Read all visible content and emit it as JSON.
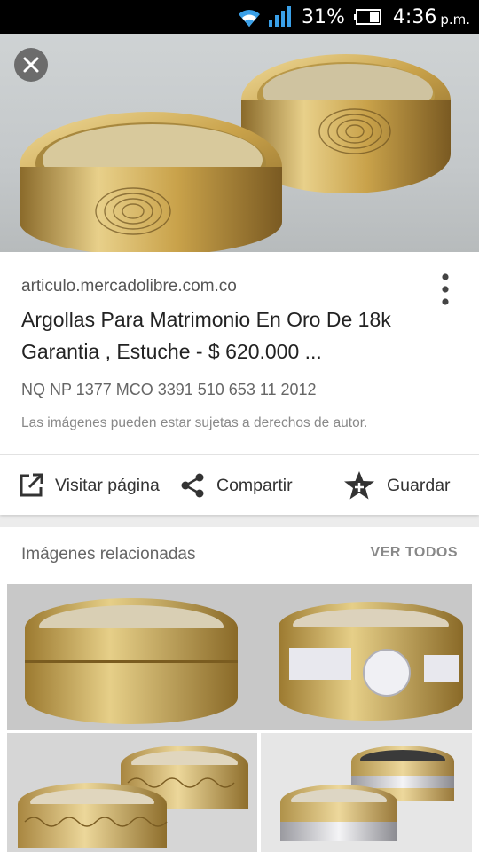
{
  "status_bar": {
    "battery_percent": "31%",
    "time": "4:36",
    "ampm": "p.m."
  },
  "hero": {
    "image_icon": "wedding-rings-photo",
    "close_icon": "close-icon"
  },
  "result": {
    "domain": "articulo.mercadolibre.com.co",
    "title": "Argollas Para Matrimonio En Oro De 18k Garantia , Estuche - $ 620.000 ...",
    "sku": "NQ NP 1377 MCO 3391 510 653 11 2012",
    "copyright": "Las imágenes pueden estar sujetas a derechos de autor."
  },
  "actions": {
    "visit_label": "Visitar página",
    "share_label": "Compartir",
    "save_label": "Guardar"
  },
  "related": {
    "title": "Imágenes relacionadas",
    "see_all": "VER TODOS"
  },
  "colors": {
    "gold": "#c9a24a",
    "status_bar": "#000000",
    "signal_blue": "#3aa0e8"
  }
}
